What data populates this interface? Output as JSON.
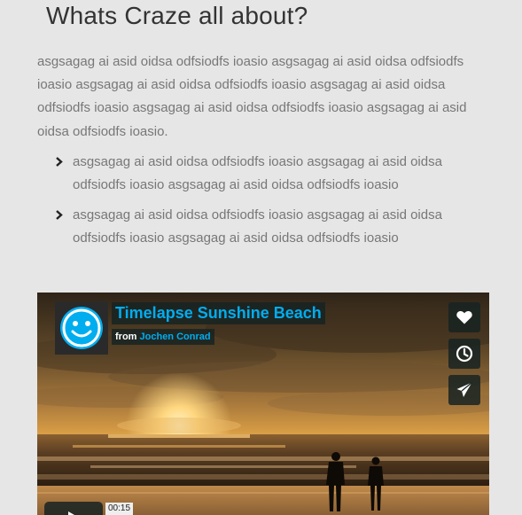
{
  "heading": "Whats Craze all about?",
  "intro": "asgsagag ai asid oidsa odfsiodfs ioasio asgsagag ai asid oidsa odfsiodfs ioasio asgsagag ai asid oidsa odfsiodfs ioasio asgsagag ai asid oidsa odfsiodfs ioasio asgsagag ai asid oidsa odfsiodfs ioasio asgsagag ai asid oidsa odfsiodfs ioasio.",
  "bullets": [
    "asgsagag ai asid oidsa odfsiodfs ioasio asgsagag ai asid oidsa odfsiodfs ioasio asgsagag ai asid oidsa odfsiodfs ioasio",
    "asgsagag ai asid oidsa odfsiodfs ioasio asgsagag ai asid oidsa odfsiodfs ioasio asgsagag ai asid oidsa odfsiodfs ioasio"
  ],
  "video": {
    "title": "Timelapse Sunshine Beach",
    "byline_prefix": "from",
    "author": "Jochen Conrad",
    "time": "00:15",
    "icons": {
      "portrait": "smiley-avatar-icon",
      "like": "heart-icon",
      "watch_later": "clock-icon",
      "share": "paper-plane-icon",
      "play": "play-icon"
    }
  },
  "colors": {
    "accent": "#00adef",
    "overlay": "#172322",
    "body_text": "#777777",
    "heading_text": "#333333",
    "page_background": "#e6e6e6"
  }
}
